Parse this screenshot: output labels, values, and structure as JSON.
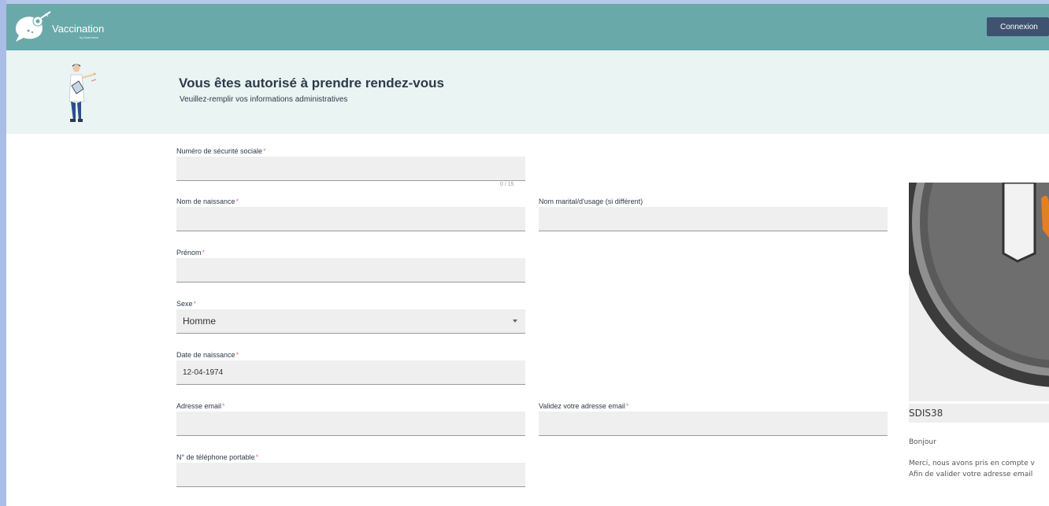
{
  "header": {
    "logo_text": "Vaccination",
    "logo_sub": "by Anamnese",
    "login_button": "Connexion"
  },
  "banner": {
    "title": "Vous êtes autorisé à prendre rendez-vous",
    "subtitle": "Veuillez-remplir vos informations administratives"
  },
  "form": {
    "social_security": {
      "label": "Numéro de sécurité sociale",
      "value": "",
      "counter": "0 / 15"
    },
    "birth_name": {
      "label": "Nom de naissance",
      "value": ""
    },
    "married_name": {
      "label": "Nom marital/d'usage (si différent)",
      "value": ""
    },
    "first_name": {
      "label": "Prénom",
      "value": ""
    },
    "sex": {
      "label": "Sexe",
      "value": "Homme"
    },
    "birth_date": {
      "label": "Date de naissance",
      "value": "12-04-1974"
    },
    "email": {
      "label": "Adresse email",
      "value": ""
    },
    "email_confirm": {
      "label": "Validez votre adresse email",
      "value": ""
    },
    "mobile": {
      "label": "N° de téléphone portable",
      "value": ""
    }
  },
  "side_panel": {
    "title": "SDIS38",
    "greeting": "Bonjour",
    "line1": "Merci, nous avons pris en compte v",
    "line2": "Afin de valider votre adresse email"
  },
  "required_mark": "*",
  "colors": {
    "header": "#6aa9aa",
    "banner": "#e9f4f3",
    "button": "#3f5270",
    "required": "#e07a7a"
  }
}
